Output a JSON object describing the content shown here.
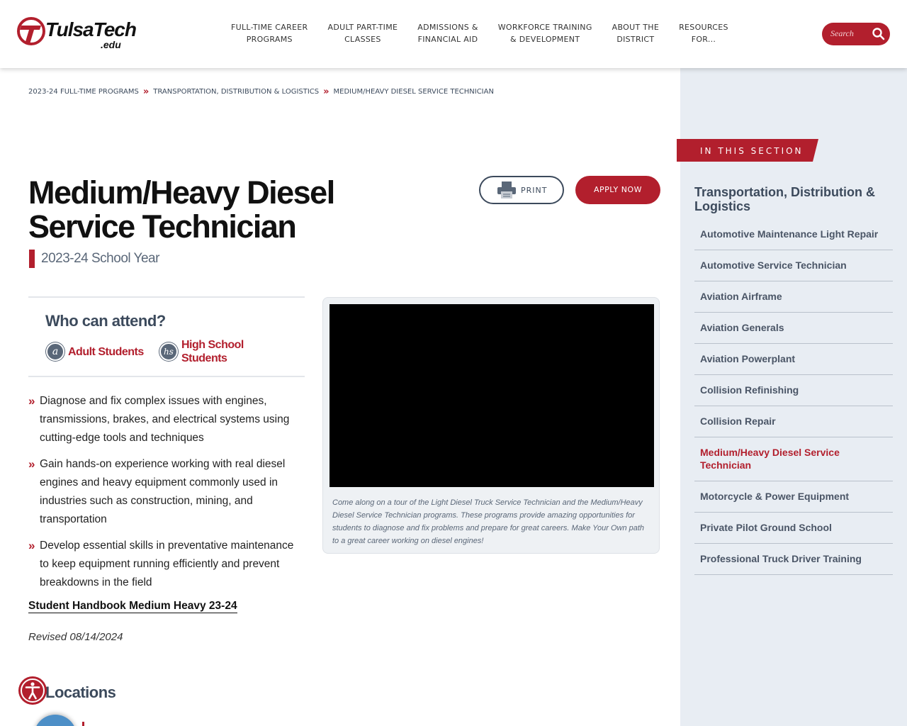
{
  "header": {
    "logo_text": "TulsaTech",
    "logo_suffix": ".edu",
    "nav": [
      {
        "line1": "FULL-TIME CAREER",
        "line2": "PROGRAMS"
      },
      {
        "line1": "ADULT PART-TIME",
        "line2": "CLASSES"
      },
      {
        "line1": "ADMISSIONS &",
        "line2": "FINANCIAL AID"
      },
      {
        "line1": "WORKFORCE TRAINING",
        "line2": "& DEVELOPMENT"
      },
      {
        "line1": "ABOUT THE",
        "line2": "DISTRICT"
      },
      {
        "line1": "RESOURCES",
        "line2": "FOR..."
      }
    ],
    "search_placeholder": "Search"
  },
  "breadcrumb": [
    "2023-24 FULL-TIME PROGRAMS",
    "TRANSPORTATION, DISTRIBUTION & LOGISTICS",
    "MEDIUM/HEAVY DIESEL SERVICE TECHNICIAN"
  ],
  "page": {
    "title_line1": "Medium/Heavy Diesel",
    "title_line2": "Service Technician",
    "school_year": "2023-24 School Year",
    "print_label": "PRINT",
    "apply_label": "APPLY NOW"
  },
  "attend": {
    "heading": "Who can attend?",
    "audiences": [
      {
        "icon": "a",
        "label": "Adult Students"
      },
      {
        "icon": "hs",
        "label_line1": "High School",
        "label_line2": "Students"
      }
    ]
  },
  "bullets": [
    "Diagnose and fix complex issues with engines, transmissions, brakes, and electrical systems using cutting-edge tools and techniques",
    "Gain hands-on experience working with real diesel engines and heavy equipment commonly used in industries such as construction, mining, and transportation",
    "Develop essential skills in preventative maintenance to keep equipment running efficiently and prevent breakdowns in the field"
  ],
  "handbook_link": "Student Handbook Medium Heavy 23-24",
  "revised": "Revised 08/14/2024",
  "video": {
    "caption": "Come along on a tour of the Light Diesel Truck Service Technician and the Medium/Heavy Diesel Service Technician programs. These programs provide amazing opportunities for students to diagnose and fix problems and prepare for great careers. Make Your Own path to a great career working on diesel engines!"
  },
  "locations_heading": "Locations",
  "sidebar": {
    "tab_label": "IN THIS SECTION",
    "title": "Transportation, Distribution & Logistics",
    "items": [
      "Automotive Maintenance Light Repair",
      "Automotive Service Technician",
      "Aviation Airframe",
      "Aviation Generals",
      "Aviation Powerplant",
      "Collision Refinishing",
      "Collision Repair",
      "Medium/Heavy Diesel Service Technician",
      "Motorcycle & Power Equipment",
      "Private Pilot Ground School",
      "Professional Truck Driver Training"
    ],
    "active_index": 7
  },
  "colors": {
    "brand_red": "#b21f2d",
    "slate": "#3c4a5c",
    "sidebar_bg": "#e8edf3"
  }
}
